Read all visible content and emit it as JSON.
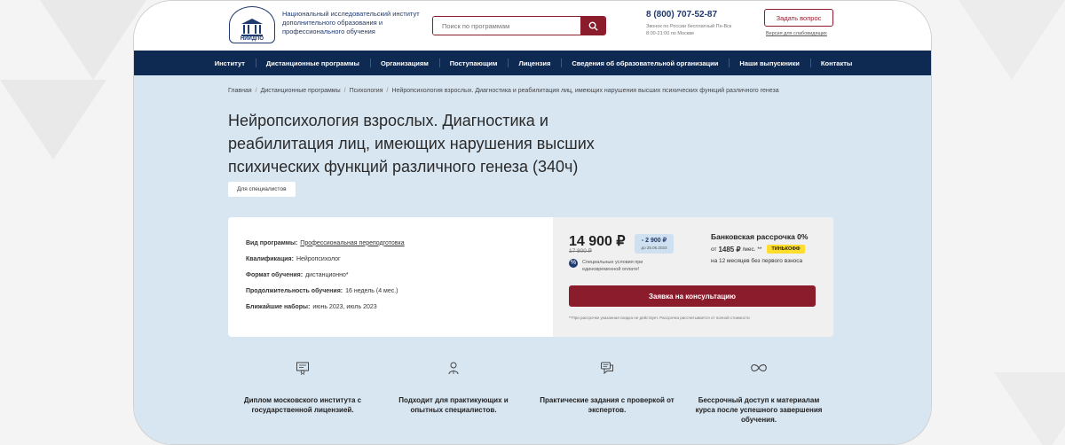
{
  "header": {
    "logo_caption": "НИИДПО",
    "institute_name": "Национальный исследовательский институт дополнительного образования и профессионального обучения",
    "search_placeholder": "Поиск по программам",
    "phone": "8 (800) 707-52-87",
    "phone_note": "Звонок по России бесплатный Пн-Вск 8:00-21:00 по Москве",
    "ask_button": "Задать вопрос",
    "vision_link": "Версия для слабовидящих"
  },
  "nav": {
    "items": [
      "Институт",
      "Дистанционные программы",
      "Организациям",
      "Поступающим",
      "Лицензия",
      "Сведения об образовательной организации",
      "Наши выпускники",
      "Контакты"
    ]
  },
  "breadcrumb": {
    "items": [
      "Главная",
      "Дистанционные программы",
      "Психология",
      "Нейропсихология взрослых. Диагностика и реабилитация лиц, имеющих нарушения высших психических функций различного генеза"
    ]
  },
  "page": {
    "title": "Нейропсихология взрослых. Диагностика и реабилитация лиц, имеющих нарушения высших психических функций различного генеза (340ч)",
    "tag": "Для специалистов"
  },
  "program": {
    "type_label": "Вид программы:",
    "type_value": "Профессиональная переподготовка",
    "qual_label": "Квалификация:",
    "qual_value": "Нейропсихолог",
    "format_label": "Формат обучения:",
    "format_value": "дистанционно*",
    "duration_label": "Продолжительность обучения:",
    "duration_value": "16 недель (4 мес.)",
    "intake_label": "Ближайшие наборы:",
    "intake_value": "июнь 2023, июль 2023"
  },
  "pricing": {
    "price": "14 900 ₽",
    "old_price": "17 800 ₽",
    "discount": "- 2 900 ₽",
    "discount_until": "до 25.06.2023",
    "special_note": "Специальные условия при единовременной оплате!",
    "bank_title": "Банковская рассрочка 0%",
    "bank_from": "от",
    "bank_amount": "1485 ₽",
    "bank_per": "/мес. **",
    "bank_partner": "ТИНЬКОФФ",
    "bank_term": "на 12 месяцев без первого взноса",
    "consult_button": "Заявка на консультацию",
    "footnote": "**При рассрочке указанная скидка не действует. Рассрочка рассчитывается от полной стоимости"
  },
  "features": [
    {
      "icon": "diploma-icon",
      "text": "Диплом московского института с государственной лицензией."
    },
    {
      "icon": "specialist-icon",
      "text": "Подходит для практикующих и опытных специалистов."
    },
    {
      "icon": "chat-icon",
      "text": "Практические задания с проверкой от экспертов."
    },
    {
      "icon": "infinity-icon",
      "text": "Бессрочный доступ к материалам курса после успешного завершения обучения."
    }
  ],
  "colors": {
    "brand_navy": "#0f2a52",
    "brand_maroon": "#8a1c2c",
    "main_bg": "#d8e6f2",
    "tinkoff_yellow": "#ffdd2d"
  }
}
